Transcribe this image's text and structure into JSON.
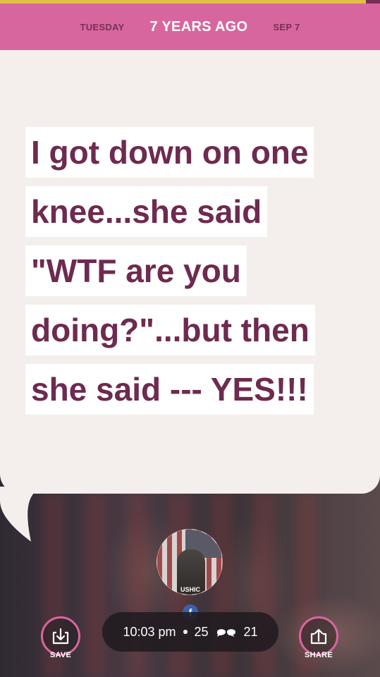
{
  "header": {
    "day": "TUESDAY",
    "relative_time": "7 YEARS AGO",
    "date": "SEP 7"
  },
  "post": {
    "lines": [
      "I got down on one",
      "knee...she said",
      "\"WTF are you",
      "doing?\"...but then",
      "she said --- YES!!!"
    ]
  },
  "avatar": {
    "caption": "USHIC"
  },
  "info": {
    "time": "10:03 pm",
    "hearts": "25",
    "comments": "21",
    "source_icon": "facebook-icon"
  },
  "actions": {
    "save_label": "SAVE",
    "share_label": "SHARE"
  },
  "colors": {
    "accent": "#d8669e",
    "text": "#6e2a4f",
    "card": "#f4efec",
    "top_strip": "#e0c044"
  }
}
